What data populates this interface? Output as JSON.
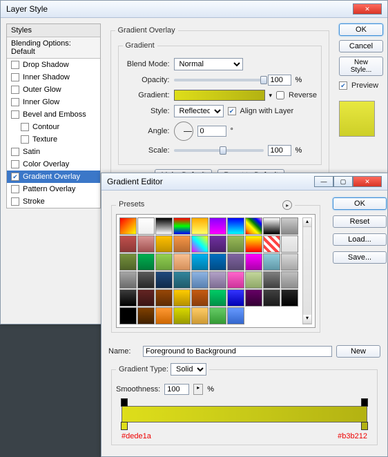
{
  "layerStyle": {
    "title": "Layer Style",
    "okBtn": "OK",
    "cancelBtn": "Cancel",
    "newStyleBtn": "New Style...",
    "previewLabel": "Preview",
    "stylesHdr": "Styles",
    "blendingHdr": "Blending Options: Default",
    "items": [
      {
        "label": "Drop Shadow"
      },
      {
        "label": "Inner Shadow"
      },
      {
        "label": "Outer Glow"
      },
      {
        "label": "Inner Glow"
      },
      {
        "label": "Bevel and Emboss"
      },
      {
        "label": "Contour",
        "sub": true
      },
      {
        "label": "Texture",
        "sub": true
      },
      {
        "label": "Satin"
      },
      {
        "label": "Color Overlay"
      },
      {
        "label": "Gradient Overlay",
        "checked": true,
        "active": true
      },
      {
        "label": "Pattern Overlay"
      },
      {
        "label": "Stroke"
      }
    ],
    "group1": "Gradient Overlay",
    "group2": "Gradient",
    "blendModeLbl": "Blend Mode:",
    "blendMode": "Normal",
    "opacityLbl": "Opacity:",
    "opacityVal": "100",
    "pct": "%",
    "gradientLbl": "Gradient:",
    "reverseLbl": "Reverse",
    "styleLbl": "Style:",
    "styleVal": "Reflected",
    "alignLbl": "Align with Layer",
    "angleLbl": "Angle:",
    "angleVal": "0",
    "deg": "°",
    "scaleLbl": "Scale:",
    "scaleVal": "100",
    "makeDefault": "Make Default",
    "resetDefault": "Reset to Default"
  },
  "gradEditor": {
    "title": "Gradient Editor",
    "okBtn": "OK",
    "resetBtn": "Reset",
    "loadBtn": "Load...",
    "saveBtn": "Save...",
    "presetsLbl": "Presets",
    "nameLbl": "Name:",
    "nameVal": "Foreground to Background",
    "newBtn": "New",
    "gradTypeLbl": "Gradient Type:",
    "gradTypeVal": "Solid",
    "smoothLbl": "Smoothness:",
    "smoothVal": "100",
    "pct": "%",
    "hexLeft": "#dede1a",
    "hexRight": "#b3b212"
  }
}
